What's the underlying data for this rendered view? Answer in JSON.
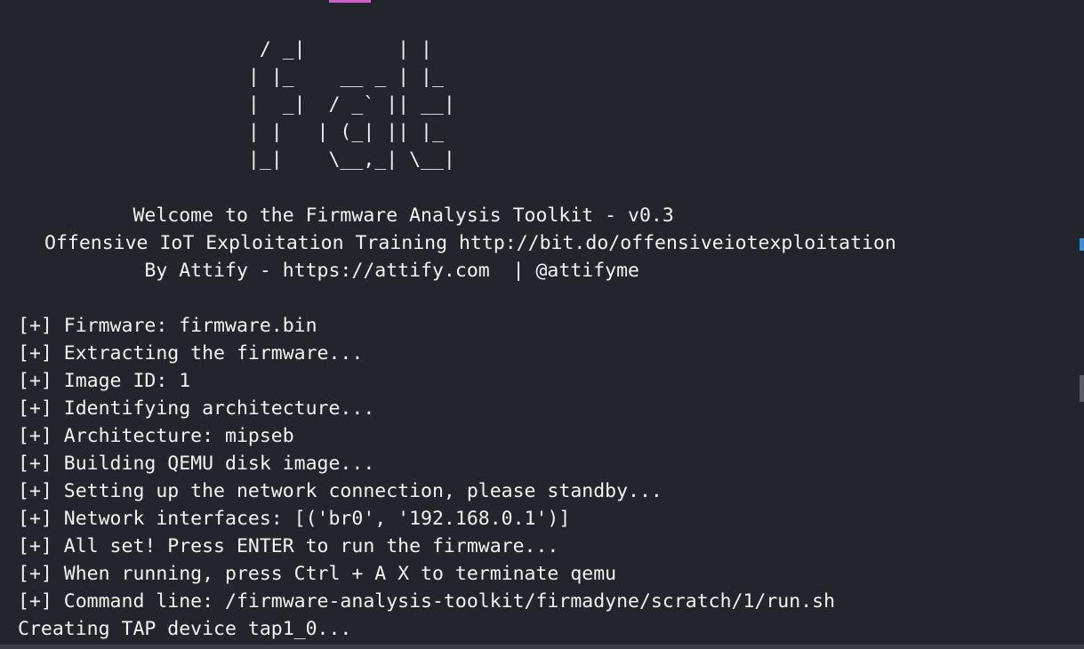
{
  "banner": {
    "ascii_art": "                     / _|        | |\n                    | |_    __ _ | |_\n                    |  _|  / _` || __|\n                    | |   | (_| || |_\n                    |_|    \\__,_| \\__|",
    "welcome": "          Welcome to the Firmware Analysis Toolkit - v0.3",
    "training": "Offensive IoT Exploitation Training http://bit.do/offensiveiotexploitation",
    "credits": "           By Attify - https://attify.com  | @attifyme"
  },
  "output": {
    "lines": [
      "[+] Firmware: firmware.bin",
      "[+] Extracting the firmware...",
      "[+] Image ID: 1",
      "[+] Identifying architecture...",
      "[+] Architecture: mipseb",
      "[+] Building QEMU disk image...",
      "[+] Setting up the network connection, please standby...",
      "[+] Network interfaces: [('br0', '192.168.0.1')]",
      "[+] All set! Press ENTER to run the firmware...",
      "[+] When running, press Ctrl + A X to terminate qemu",
      "[+] Command line: /firmware-analysis-toolkit/firmadyne/scratch/1/run.sh",
      "Creating TAP device tap1_0..."
    ]
  },
  "colors": {
    "background": "#22252b",
    "foreground": "#f2f2f2",
    "accent": "#d060c8",
    "scroll_marker": "#3a8fd0"
  }
}
